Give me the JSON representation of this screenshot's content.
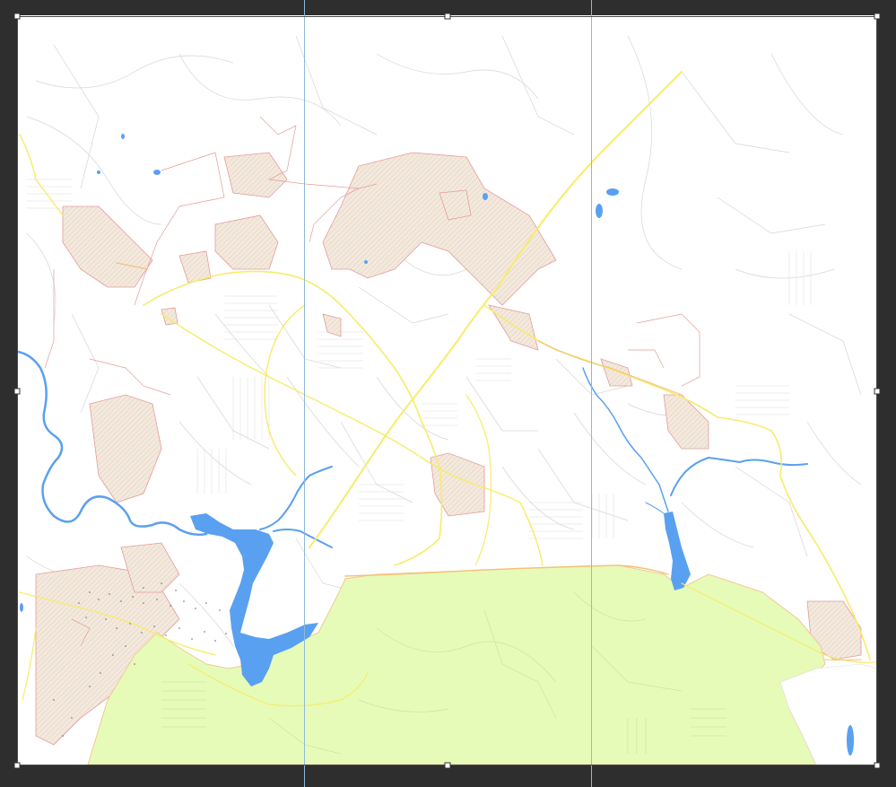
{
  "workspace": {
    "pasteboard_color": "#2e2e2e",
    "artboard_color": "#ffffff",
    "guide_color": "#8fb8d8",
    "selection_color": "#4a4a4a",
    "guide_count": 2
  },
  "map": {
    "colors": {
      "water": "#5aa0f0",
      "parkland": "#e6fbb8",
      "parkland_edge": "#f2c896",
      "major_road": "#f7ec6a",
      "arterial_road": "#f4c27a",
      "minor_street": "#d4d4d4",
      "development_fill": "#efe2d4",
      "development_edge": "#e49c9c",
      "clearing": "#ffffff"
    },
    "layers": [
      "streets",
      "developments",
      "water",
      "parkland",
      "major-roads"
    ]
  }
}
